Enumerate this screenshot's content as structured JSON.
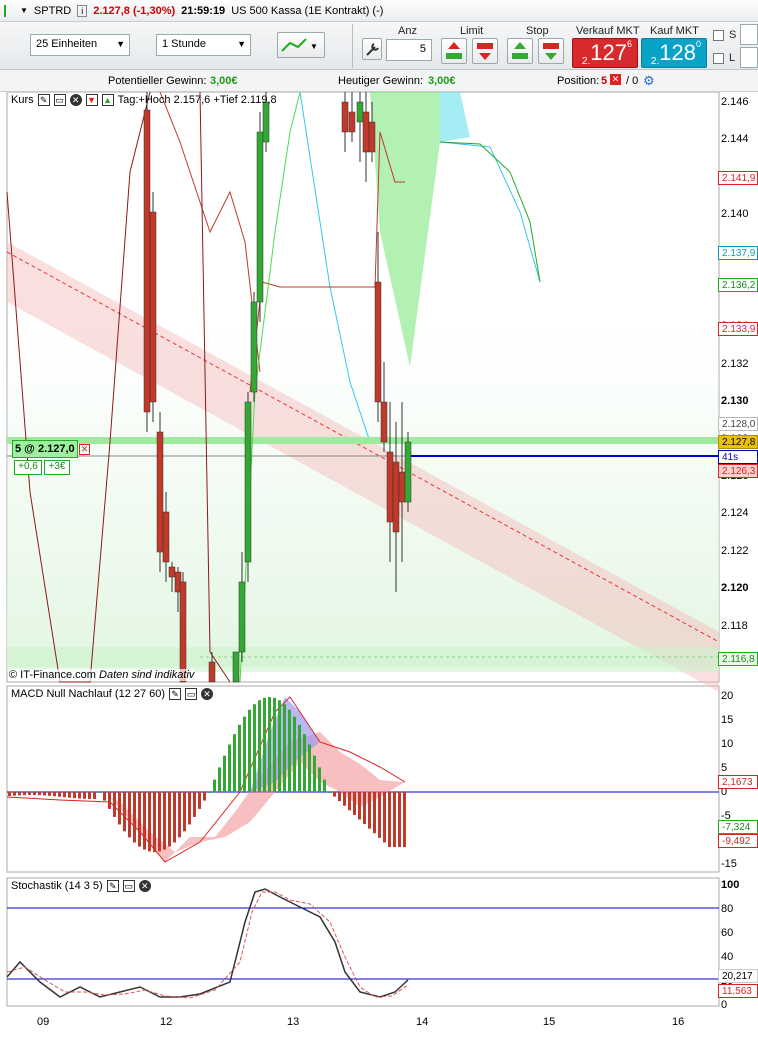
{
  "titlebar": {
    "symbol": "SPTRD",
    "price_change": "2.127,8 (-1,30%)",
    "time": "21:59:19",
    "instrument": "US 500 Kassa (1E Kontrakt) (-)"
  },
  "toolbar": {
    "units_select": "25 Einheiten",
    "interval_select": "1 Stunde",
    "anz_label": "Anz",
    "anz_value": "5",
    "limit_label": "Limit",
    "stop_label": "Stop",
    "sell_label": "Verkauf MKT",
    "buy_label": "Kauf MKT",
    "sell_prefix": "2.",
    "sell_main": "127",
    "sell_sup": "6",
    "buy_prefix": "2.",
    "buy_main": "128",
    "buy_sup": "0",
    "s_label": "S",
    "l_label": "L"
  },
  "infobar": {
    "potential_label": "Potentieller Gewinn:",
    "potential_value": "3,00€",
    "today_label": "Heutiger Gewinn:",
    "today_value": "3,00€",
    "position_label": "Position:",
    "position_value": "5",
    "position_sep": "/ 0"
  },
  "price_panel": {
    "title": "Kurs",
    "stats": "Tag:+Hoch 2.157,6 +Tief 2.119,8",
    "copyright": "© IT-Finance.com",
    "disclaimer": "Daten sind indikativ",
    "position_tag": "5 @ 2.127,0",
    "pnl_points": "+0,6",
    "pnl_euro": "+3€",
    "countdown": "41s",
    "axis": [
      "2.146",
      "2.144",
      "2.142",
      "2.140",
      "2.138",
      "2.136",
      "2.134",
      "2.132",
      "2.130",
      "2.128",
      "2.126",
      "2.124",
      "2.122",
      "2.120",
      "2.118",
      "2.116"
    ],
    "tags": {
      "t1": "2.141,9",
      "t2": "2.137,9",
      "t3": "2.136,2",
      "t4": "2.133,9",
      "t5": "2.128,0",
      "t6": "2.127,8",
      "t7": "2.126,3",
      "t8": "2.116,8"
    }
  },
  "macd_panel": {
    "title": "MACD Null Nachlauf (12 27 60)",
    "axis": [
      "20",
      "15",
      "10",
      "5",
      "0",
      "-5",
      "-10",
      "-15"
    ],
    "tags": {
      "t1": "2,1673",
      "t2": "-7,324",
      "t3": "-9,492"
    }
  },
  "stoch_panel": {
    "title": "Stochastik (14 3 5)",
    "axis": [
      "100",
      "80",
      "60",
      "40",
      "20",
      "0"
    ],
    "tags": {
      "t1": "20,217",
      "t2": "11,563"
    }
  },
  "xaxis": [
    "09",
    "12",
    "13",
    "14",
    "15",
    "16"
  ],
  "colors": {
    "up": "#33a833",
    "down": "#c0392b",
    "cloud_green": "#7ee87e",
    "cloud_cyan": "#7fe6f0",
    "trend": "#ee3333"
  }
}
